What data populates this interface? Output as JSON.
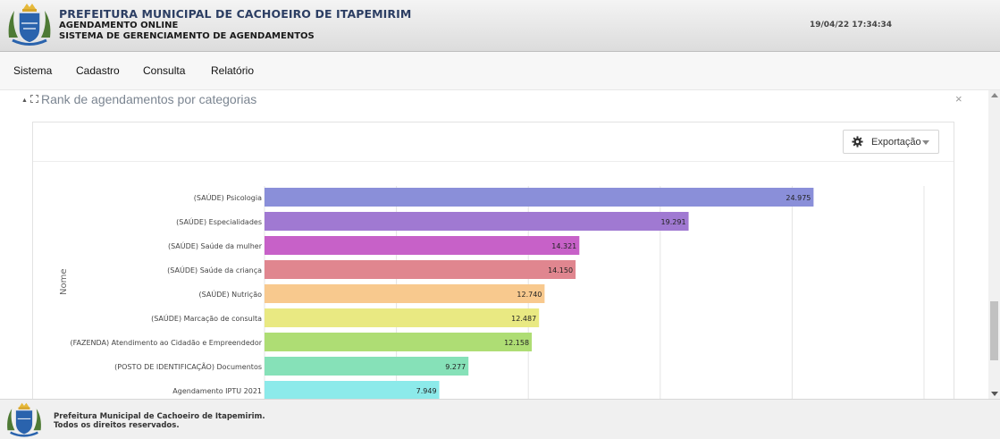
{
  "header": {
    "title": "PREFEITURA MUNICIPAL DE CACHOEIRO DE ITAPEMIRIM",
    "subtitle1": "AGENDAMENTO ONLINE",
    "subtitle2": "SISTEMA DE GERENCIAMENTO DE AGENDAMENTOS",
    "datetime": "19/04/22 17:34:34"
  },
  "menu": {
    "items": [
      {
        "label": "Sistema"
      },
      {
        "label": "Cadastro"
      },
      {
        "label": "Consulta"
      },
      {
        "label": "Relatório"
      }
    ]
  },
  "panel": {
    "title": "Rank de agendamentos por categorias",
    "close": "×",
    "export_label": "Exportação"
  },
  "chart_data": {
    "type": "bar",
    "orientation": "horizontal",
    "ylabel": "Nome",
    "categories": [
      "(SAÚDE) Psicologia",
      "(SAÚDE) Especialidades",
      "(SAÚDE) Saúde da mulher",
      "(SAÚDE) Saúde da criança",
      "(SAÚDE) Nutrição",
      "(SAÚDE) Marcação de consulta",
      "(FAZENDA) Atendimento ao Cidadão e Empreendedor",
      "(POSTO DE IDENTIFICAÇÃO) Documentos",
      "Agendamento IPTU 2021"
    ],
    "values": [
      24975,
      19291,
      14321,
      14150,
      12740,
      12487,
      12158,
      9277,
      7949
    ],
    "value_labels": [
      "24.975",
      "19.291",
      "14.321",
      "14.150",
      "12.740",
      "12.487",
      "12.158",
      "9.277",
      "7.949"
    ],
    "colors": [
      "#8a8fd9",
      "#a079d2",
      "#c761c8",
      "#e0868f",
      "#f8c98e",
      "#e9e982",
      "#aedd74",
      "#86e1b8",
      "#8ceaea"
    ],
    "xlim": [
      0,
      30000
    ],
    "gridlines": [
      0,
      6000,
      12000,
      18000,
      24000,
      30000
    ],
    "grid": true,
    "legend": "none"
  },
  "footer": {
    "line1": "Prefeitura Municipal de Cachoeiro de Itapemirim.",
    "line2": "Todos os direitos reservados."
  },
  "icons": {
    "crest": "coat-of-arms-icon",
    "export": "gear-icon"
  }
}
